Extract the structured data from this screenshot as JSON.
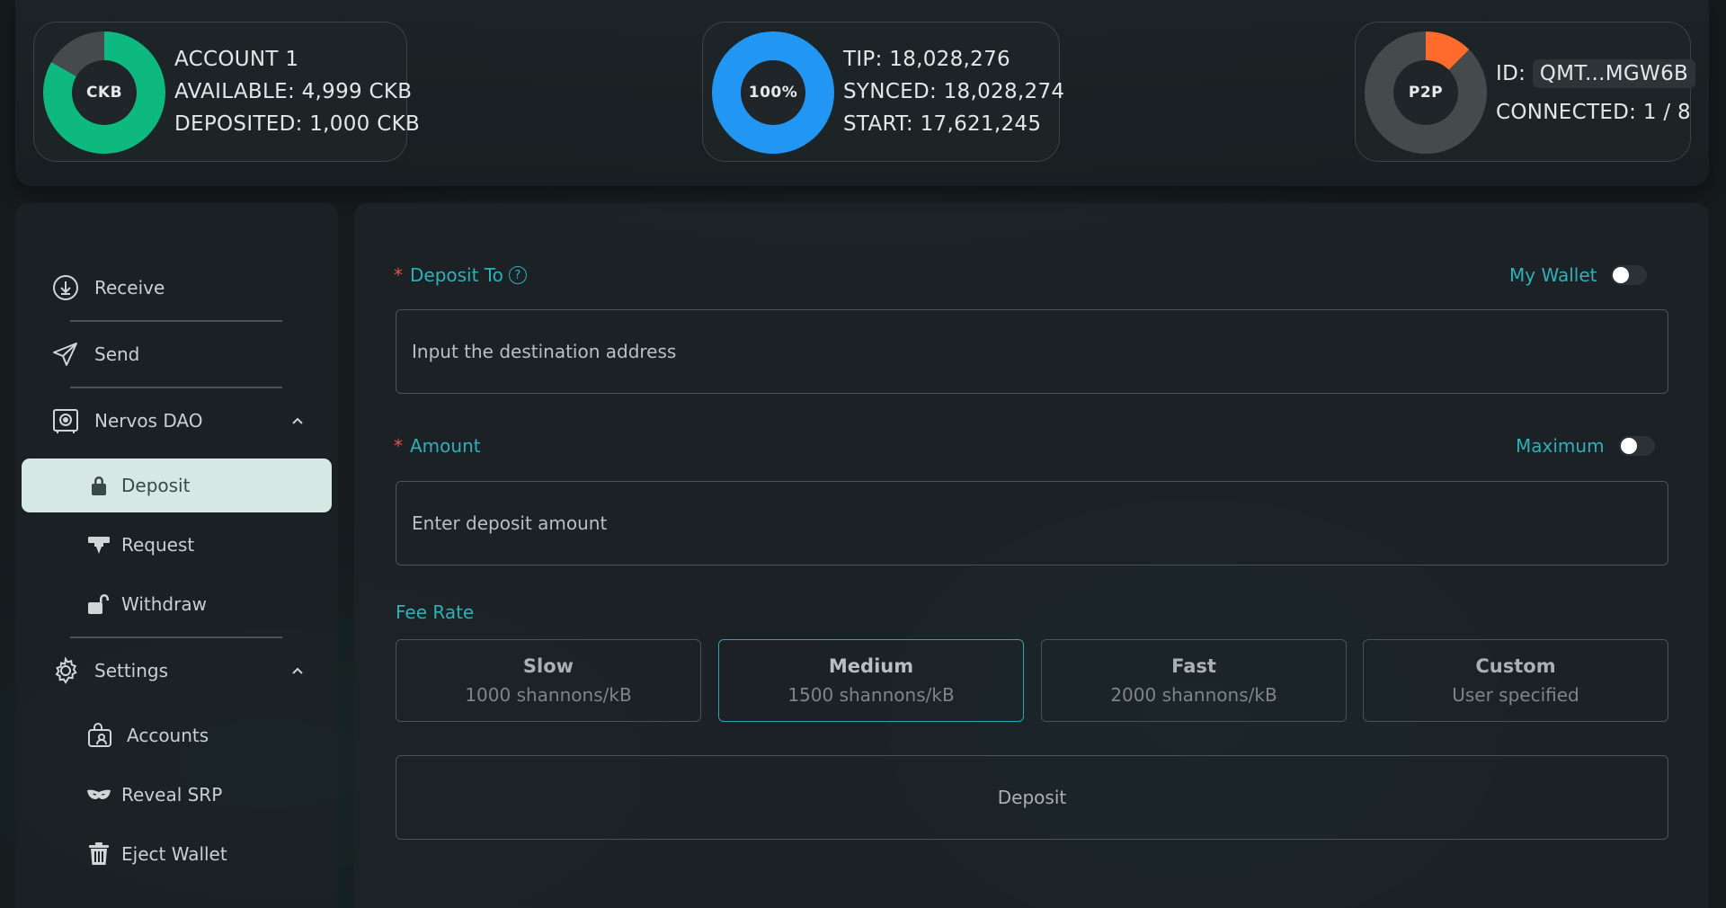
{
  "status": {
    "account": {
      "ring_label": "CKB",
      "name": "ACCOUNT 1",
      "available": "AVAILABLE: 4,999 CKB",
      "deposited": "DEPOSITED: 1,000 CKB",
      "available_fraction": 0.833
    },
    "sync": {
      "ring_label": "100%",
      "tip": "TIP: 18,028,276",
      "synced": "SYNCED: 18,028,274",
      "start": "START: 17,621,245",
      "progress_fraction": 1.0
    },
    "p2p": {
      "ring_label": "P2P",
      "id_label": "ID:",
      "id_value": "QMT...MGW6B",
      "connected": "CONNECTED: 1 / 8",
      "connected_fraction": 0.125
    }
  },
  "sidebar": {
    "receive": "Receive",
    "send": "Send",
    "nervos_dao": "Nervos DAO",
    "deposit": "Deposit",
    "request": "Request",
    "withdraw": "Withdraw",
    "settings": "Settings",
    "accounts": "Accounts",
    "reveal_srp": "Reveal SRP",
    "eject_wallet": "Eject Wallet"
  },
  "form": {
    "deposit_to_label": "Deposit To",
    "help_glyph": "?",
    "my_wallet_label": "My Wallet",
    "address_placeholder": "Input the destination address",
    "amount_label": "Amount",
    "maximum_label": "Maximum",
    "amount_placeholder": "Enter deposit amount",
    "fee_rate_label": "Fee Rate",
    "fee_options": [
      {
        "name": "Slow",
        "rate": "1000 shannons/kB"
      },
      {
        "name": "Medium",
        "rate": "1500 shannons/kB"
      },
      {
        "name": "Fast",
        "rate": "2000 shannons/kB"
      },
      {
        "name": "Custom",
        "rate": "User specified"
      }
    ],
    "submit_label": "Deposit"
  },
  "colors": {
    "account_ring": "#0db97f",
    "sync_ring": "#2196f3",
    "p2p_ring": "#ff6b2c",
    "ring_track": "#454b4d",
    "accent": "#2fb0b8"
  }
}
